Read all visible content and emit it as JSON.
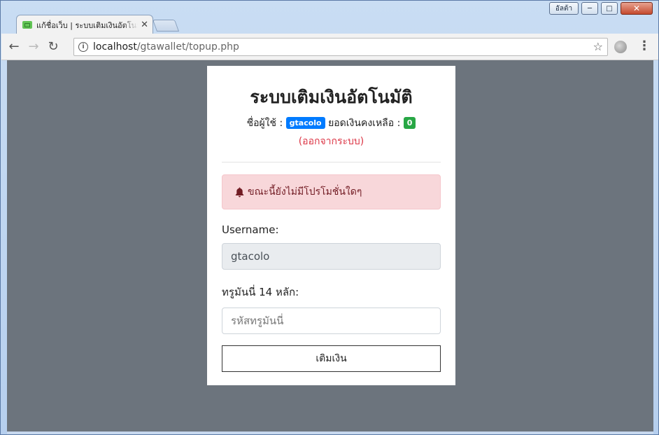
{
  "browser": {
    "tab_title": "แก้ชื่อเว็บ | ระบบเติมเงินอัตโนมัติ",
    "url_host": "localhost",
    "url_path": "/gtawallet/topup.php",
    "user_button_label": "อัลต้า"
  },
  "page": {
    "title": "ระบบเติมเงินอัตโนมัติ",
    "username_label": "ชื่อผู้ใช้ :",
    "username_value": "gtacolo",
    "balance_label": "ยอดเงินคงเหลือ :",
    "balance_value": "0",
    "logout_link": "(ออกจากระบบ)",
    "alert_text": "ขณะนี้ยังไม่มีโปรโมชั่นใดๆ",
    "form": {
      "username_field_label": "Username:",
      "username_field_value": "gtacolo",
      "truemoney_label": "ทรูมันนี่ 14 หลัก:",
      "truemoney_placeholder": "รหัสทรูมันนี่",
      "submit_label": "เติมเงิน"
    }
  },
  "colors": {
    "username_badge": "#007bff",
    "balance_badge": "#28a745",
    "logout": "#dc3545",
    "alert_bg": "#f8d7da",
    "page_bg": "#6c747d"
  }
}
